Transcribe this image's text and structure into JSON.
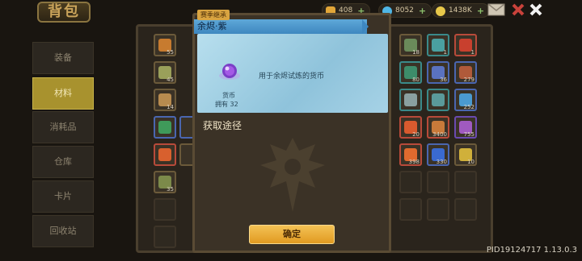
{
  "header": {
    "title": "背包",
    "currencies": [
      {
        "icon": "gold-nugget-icon",
        "value": "408",
        "color": "#e2a638"
      },
      {
        "icon": "blue-gem-icon",
        "value": "8052",
        "color": "#4fb6e6"
      },
      {
        "icon": "coin-icon",
        "value": "1438K",
        "color": "#e8c84a"
      }
    ],
    "mail_icon": "mail-icon",
    "close_icon": "close-icon"
  },
  "sidebar": {
    "tabs": [
      {
        "label": "装备",
        "active": false
      },
      {
        "label": "材料",
        "active": true
      },
      {
        "label": "消耗品",
        "active": false
      },
      {
        "label": "仓库",
        "active": false
      },
      {
        "label": "卡片",
        "active": false
      },
      {
        "label": "回收站",
        "active": false
      }
    ]
  },
  "grid": {
    "left_counts": [
      "55",
      "45",
      "14",
      "",
      "",
      "35"
    ],
    "right_counts": [
      "18",
      "1",
      "1",
      "80",
      "36",
      "279",
      "",
      "",
      "252",
      "20",
      "3400",
      "755",
      "398",
      "330",
      "10"
    ]
  },
  "modal": {
    "tag": "赛季继承",
    "title": "余烬·紫",
    "description": "用于余烬试炼的货币",
    "item_name": "货币",
    "owned": "拥有 32",
    "obtain_title": "获取途径",
    "confirm_label": "确定"
  },
  "footer": {
    "pid": "PID19124717 1.13.0.3"
  },
  "colors": {
    "accent": "#e19a21",
    "titlebar": "#4a97cc",
    "active_tab": "#a8922e"
  }
}
